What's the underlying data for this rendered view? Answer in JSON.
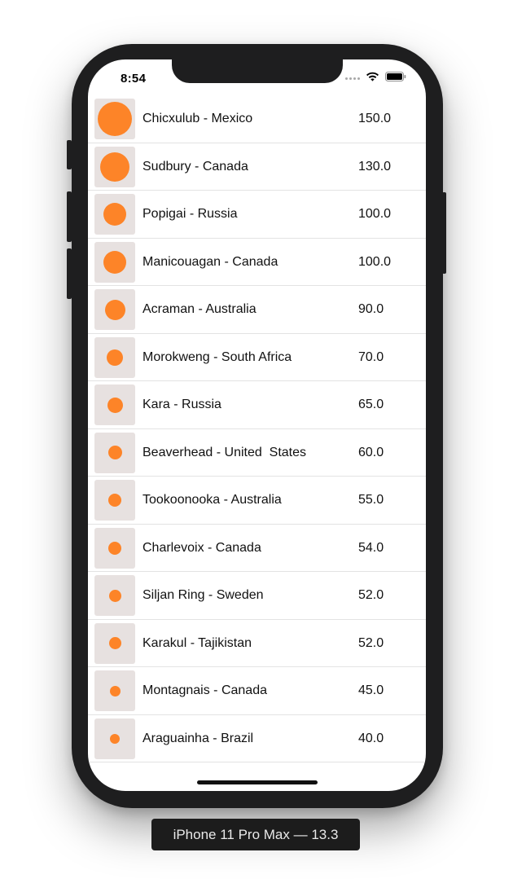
{
  "status_bar": {
    "time": "8:54"
  },
  "craters": [
    {
      "name": "Chicxulub - Mexico",
      "size": "150.0",
      "dot": 150
    },
    {
      "name": "Sudbury - Canada",
      "size": "130.0",
      "dot": 130
    },
    {
      "name": "Popigai - Russia",
      "size": "100.0",
      "dot": 100
    },
    {
      "name": "Manicouagan - Canada",
      "size": "100.0",
      "dot": 100
    },
    {
      "name": "Acraman - Australia",
      "size": "90.0",
      "dot": 90
    },
    {
      "name": "Morokweng - South Africa",
      "size": "70.0",
      "dot": 70
    },
    {
      "name": "Kara - Russia",
      "size": "65.0",
      "dot": 65
    },
    {
      "name": "Beaverhead - United  States",
      "size": "60.0",
      "dot": 60
    },
    {
      "name": "Tookoonooka - Australia",
      "size": "55.0",
      "dot": 55
    },
    {
      "name": "Charlevoix - Canada",
      "size": "54.0",
      "dot": 54
    },
    {
      "name": "Siljan Ring - Sweden",
      "size": "52.0",
      "dot": 52
    },
    {
      "name": "Karakul - Tajikistan",
      "size": "52.0",
      "dot": 52
    },
    {
      "name": "Montagnais - Canada",
      "size": "45.0",
      "dot": 45
    },
    {
      "name": "Araguainha - Brazil",
      "size": "40.0",
      "dot": 40
    }
  ],
  "device_label": "iPhone 11 Pro Max — 13.3",
  "colors": {
    "accent": "#fd8428",
    "thumb_bg": "#e7e1e0",
    "device": "#1e1e1f"
  }
}
